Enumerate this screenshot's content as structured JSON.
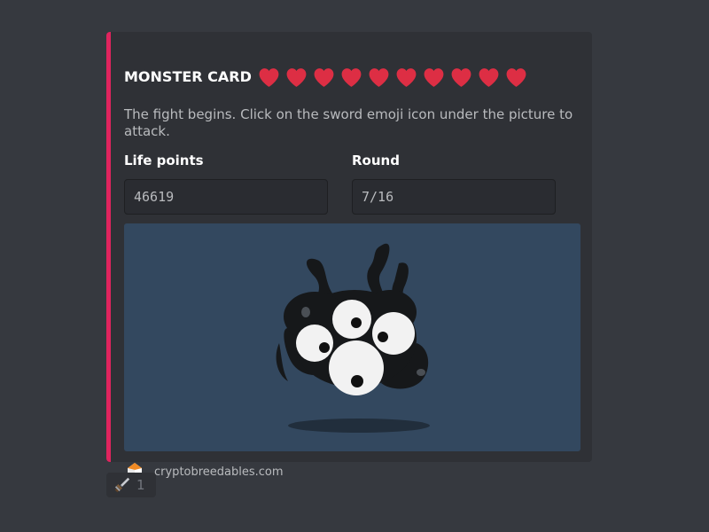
{
  "embed": {
    "accent_color": "#e0245e",
    "title": "MONSTER CARD",
    "hearts_count": 10,
    "heart_icon": "red-heart-icon",
    "description": "The fight begins. Click on the sword emoji icon under the picture to attack.",
    "fields": [
      {
        "label": "Life points",
        "value": "46619"
      },
      {
        "label": "Round",
        "value": "7/16"
      }
    ],
    "image": {
      "description_icon": "monster-illustration",
      "background_color": "#33485f"
    },
    "footer": {
      "icon": "cryptobreedables-logo-icon",
      "text": "cryptobreedables.com"
    }
  },
  "reaction": {
    "emoji_icon": "sword-icon",
    "count": "1"
  }
}
